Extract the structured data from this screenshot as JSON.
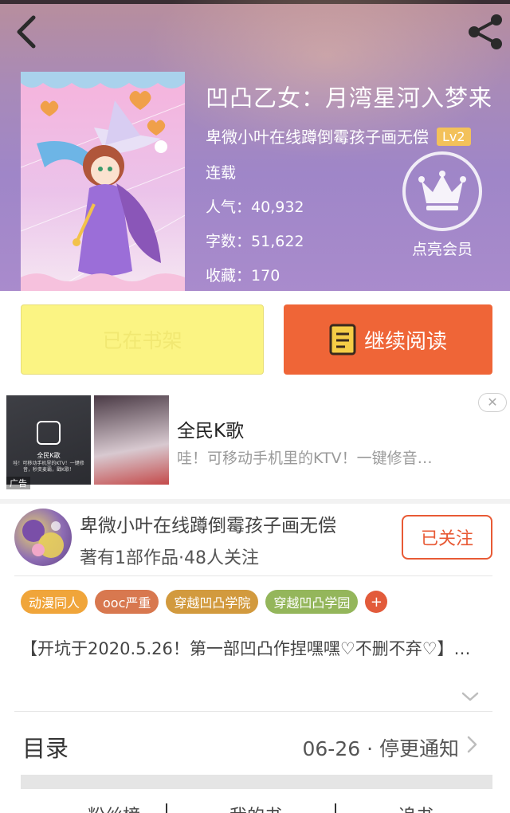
{
  "book": {
    "title": "凹凸乙女：月湾星河入梦来",
    "author": "卑微小叶在线蹲倒霉孩子画无偿",
    "level": "Lv2",
    "status": "连载",
    "popularity_label": "人气",
    "popularity": "40,932",
    "words_label": "字数",
    "words": "51,622",
    "favorites_label": "收藏",
    "favorites": "170",
    "colon": "："
  },
  "vip": {
    "label": "点亮会员"
  },
  "actions": {
    "shelf": "已在书架",
    "read": "继续阅读"
  },
  "ad": {
    "title": "全民K歌",
    "desc": "哇！可移动手机里的KTV！一键修音…",
    "tag": "广告",
    "close": "✕",
    "image_caption": "全民K歌",
    "image_text": "哇！可移动手机里的KTV！一键修音，秒变麦霸，戳K歌！"
  },
  "author": {
    "name": "卑微小叶在线蹲倒霉孩子画无偿",
    "stats": "著有1部作品·48人关注",
    "follow": "已关注"
  },
  "tags": [
    {
      "label": "动漫同人",
      "color": "#f0a53a"
    },
    {
      "label": "ooc严重",
      "color": "#d8784f"
    },
    {
      "label": "穿越凹凸学院",
      "color": "#d29a3e"
    },
    {
      "label": "穿越凹凸学园",
      "color": "#94b65b"
    }
  ],
  "tag_add": "+",
  "intro": "【开坑于2020.5.26！第一部凹凸作捏嘿嘿♡不删不弃♡】…",
  "catalog": {
    "label": "目录",
    "update": "06-26 · 停更通知"
  },
  "bottom_tabs": [
    "粉丝榜",
    "我的书",
    "追书"
  ],
  "icons": {
    "back": "chevron-left-icon",
    "share": "share-icon",
    "vip": "crown-icon",
    "read": "book-icon",
    "expand": "chevron-down-icon",
    "catalog": "chevron-right-icon"
  },
  "colors": {
    "accent": "#ef6537",
    "shelf": "#fbf483",
    "follow": "#e85a35"
  }
}
